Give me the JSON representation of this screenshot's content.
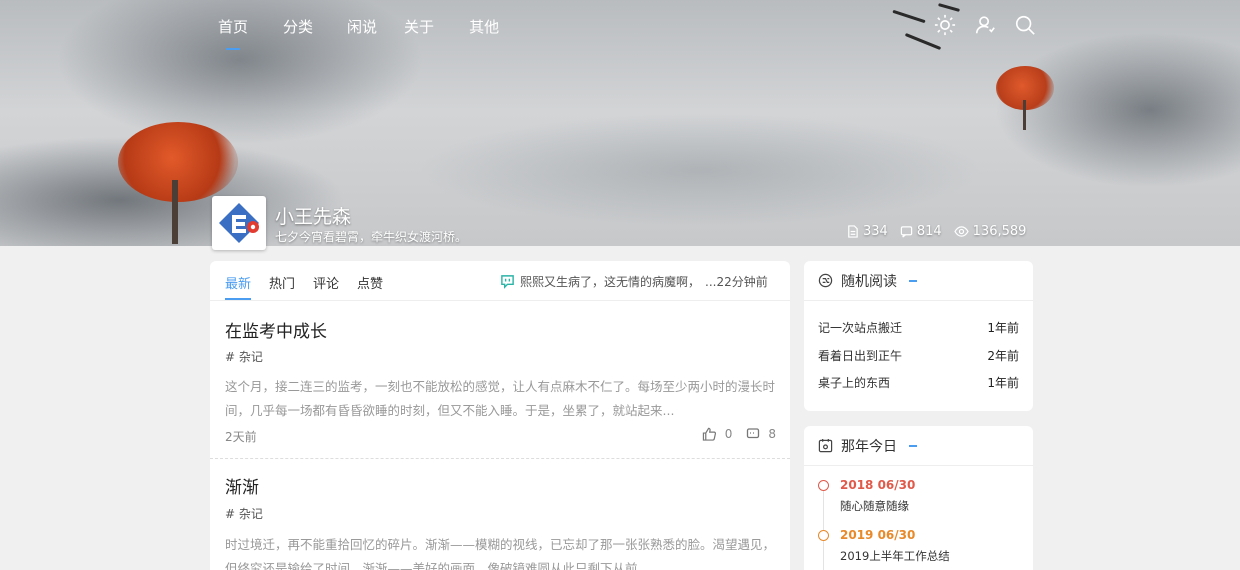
{
  "nav": {
    "items": [
      {
        "label": "首页",
        "active": true
      },
      {
        "label": "分类"
      },
      {
        "label": "闲说"
      },
      {
        "label": "关于"
      },
      {
        "label": "其他"
      }
    ]
  },
  "header_icons": [
    "sun-icon",
    "user-icon",
    "search-icon"
  ],
  "profile": {
    "name": "小王先森",
    "motto": "七夕今宵看碧霄，牵牛织女渡河桥。",
    "stats": {
      "articles": "334",
      "comments": "814",
      "views": "136,589"
    }
  },
  "feed": {
    "tabs": [
      {
        "label": "最新",
        "active": true
      },
      {
        "label": "热门"
      },
      {
        "label": "评论"
      },
      {
        "label": "点赞"
      }
    ],
    "notice": {
      "text": "熙熙又生病了，这无情的病魔啊，",
      "time": "...22分钟前"
    },
    "posts": [
      {
        "title": "在监考中成长",
        "tag": "# 杂记",
        "excerpt": "这个月，接二连三的监考，一刻也不能放松的感觉，让人有点麻木不仁了。每场至少两小时的漫长时间，几乎每一场都有昏昏欲睡的时刻，但又不能入睡。于是，坐累了，就站起来...",
        "time": "2天前",
        "likes": "0",
        "comments": "8"
      },
      {
        "title": "渐渐",
        "tag": "# 杂记",
        "excerpt": "时过境迁，再不能重拾回忆的碎片。渐渐——模糊的视线，已忘却了那一张张熟悉的脸。渴望遇见，但终究还是输给了时间。渐渐——美好的画面，像破镜难圆从此只剩下从前。"
      }
    ]
  },
  "random_read": {
    "title": "随机阅读",
    "items": [
      {
        "title": "记一次站点搬迁",
        "time": "1年前"
      },
      {
        "title": "看着日出到正午",
        "time": "2年前"
      },
      {
        "title": "桌子上的东西",
        "time": "1年前"
      }
    ]
  },
  "on_this_day": {
    "title": "那年今日",
    "items": [
      {
        "date": "2018 06/30",
        "text": "随心随意随缘",
        "color": "#e05a4a"
      },
      {
        "date": "2019 06/30",
        "text": "2019上半年工作总结",
        "color": "#e8892a"
      }
    ]
  },
  "colors": {
    "accent": "#4a9df0"
  }
}
